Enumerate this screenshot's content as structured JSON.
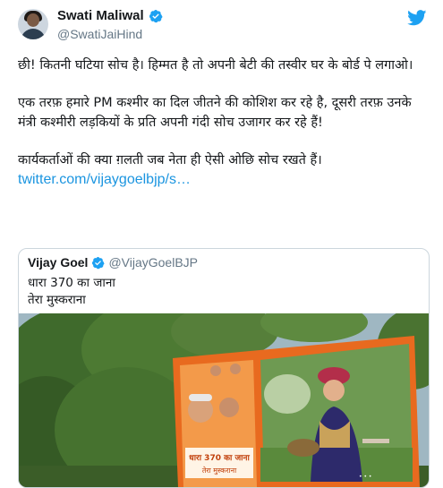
{
  "author": {
    "name": "Swati Maliwal",
    "handle": "@SwatiJaiHind"
  },
  "tweet": {
    "paragraphs": [
      "छी! कितनी घटिया सोच है। हिम्मत है तो अपनी बेटी की तस्वीर घर के बोर्ड पे लगाओ।",
      "एक तरफ़ हमारे PM कश्मीर का दिल जीतने की कोशिश कर रहे है, दूसरी तरफ़ उनके मंत्री कश्मीरी लड़कियों के प्रति अपनी गंदी सोच उजागर कर रहे हैं!",
      "कार्यकर्ताओं की क्या ग़लती जब नेता ही ऐसी ओछि सोच रखते हैं।"
    ],
    "link": "twitter.com/vijaygoelbjp/s…"
  },
  "quoted": {
    "name": "Vijay Goel",
    "handle": "@VijayGoelBJP",
    "line1": "धारा 370 का जाना",
    "line2": "तेरा मुस्कराना",
    "billboard_text_1": "धारा 370 का जाना",
    "billboard_text_2": "तेरा मुस्कराना"
  },
  "colors": {
    "twitter_blue": "#1da1f2",
    "link_blue": "#1b95e0",
    "billboard_orange": "#f07a2a"
  },
  "icons": {
    "verified": "verified-badge-icon",
    "bird": "twitter-bird-icon"
  }
}
